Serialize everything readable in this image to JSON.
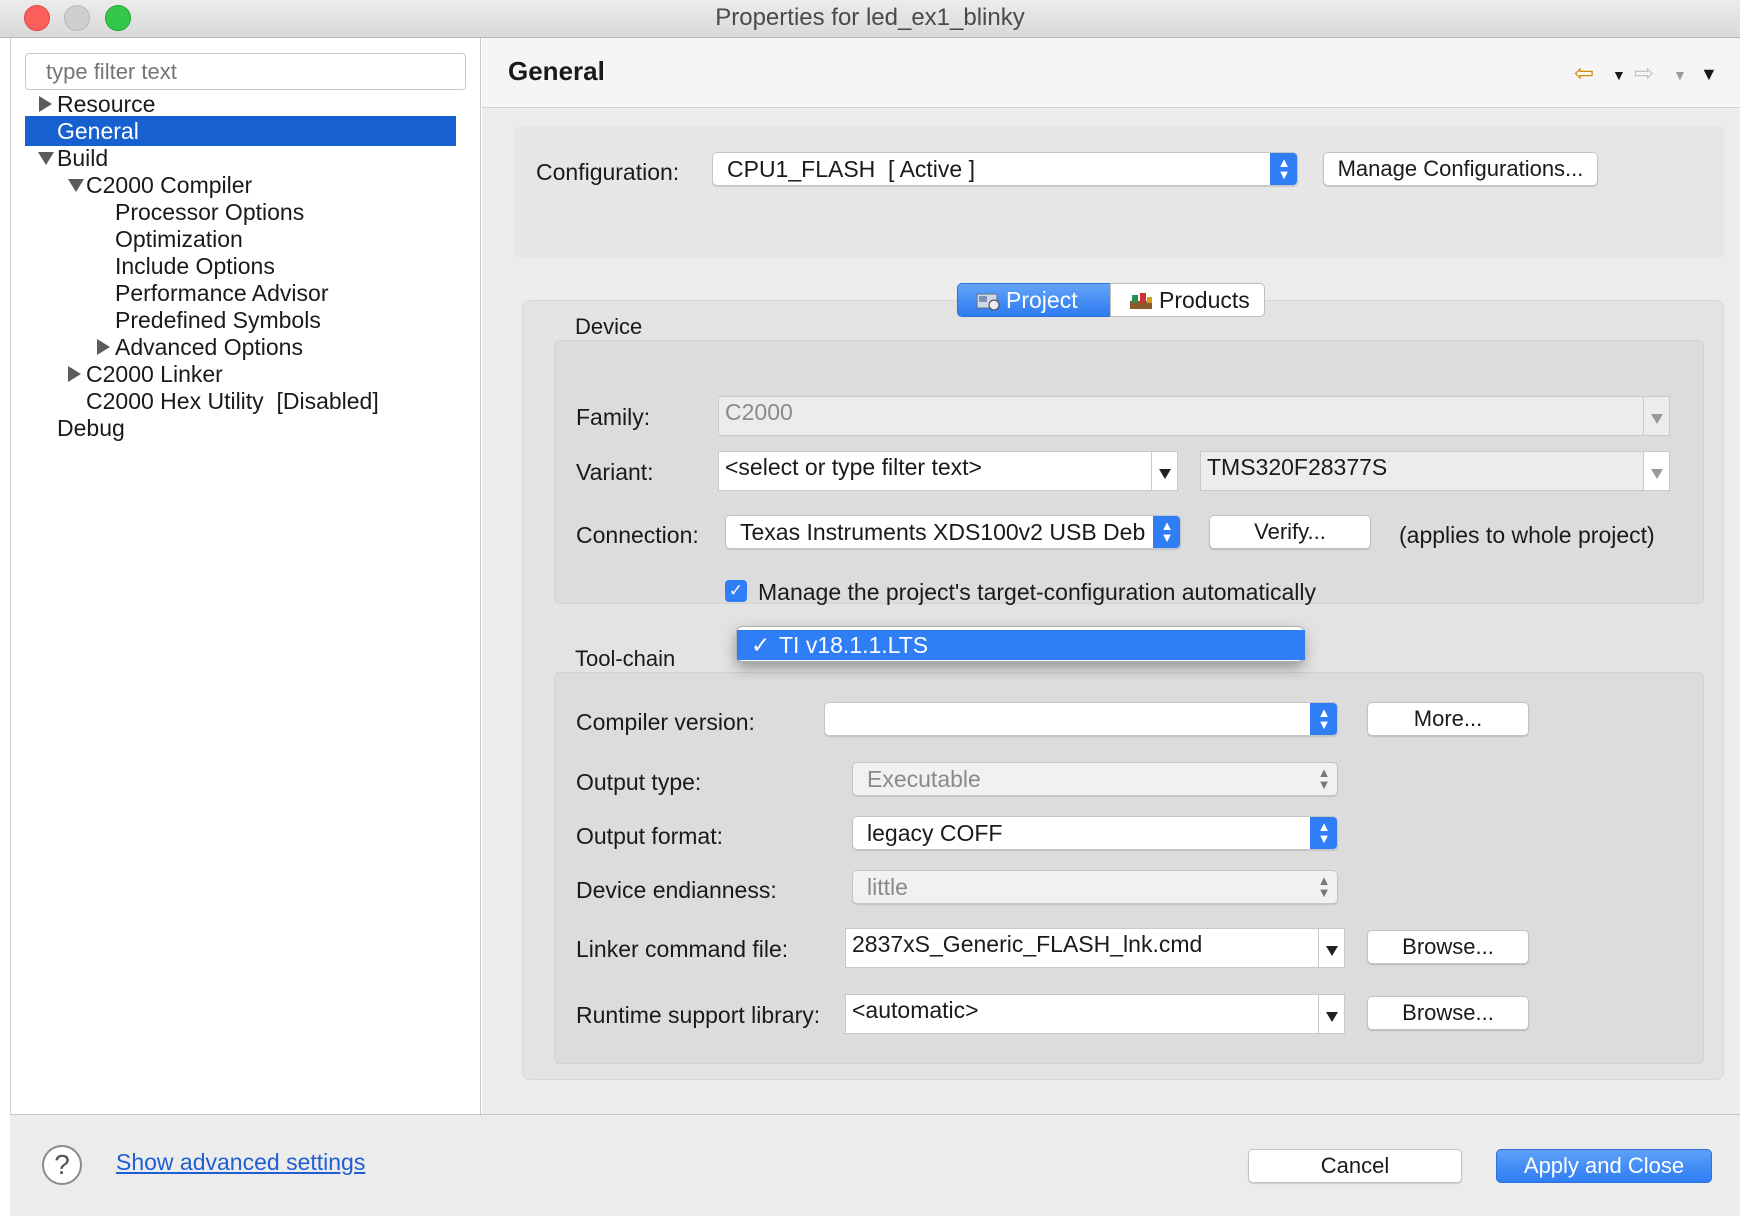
{
  "window": {
    "title": "Properties for led_ex1_blinky"
  },
  "sidebar": {
    "filter_placeholder": "type filter text",
    "items": [
      {
        "label": "Resource"
      },
      {
        "label": "General"
      },
      {
        "label": "Build"
      },
      {
        "label": "C2000 Compiler"
      },
      {
        "label": "Processor Options"
      },
      {
        "label": "Optimization"
      },
      {
        "label": "Include Options"
      },
      {
        "label": "Performance Advisor"
      },
      {
        "label": "Predefined Symbols"
      },
      {
        "label": "Advanced Options"
      },
      {
        "label": "C2000 Linker"
      },
      {
        "label": "C2000 Hex Utility  [Disabled]"
      },
      {
        "label": "Debug"
      }
    ],
    "selected": "General"
  },
  "main": {
    "title": "General",
    "configuration": {
      "label": "Configuration:",
      "value": "CPU1_FLASH  [ Active ]",
      "manage_label": "Manage Configurations..."
    },
    "tabs": [
      {
        "label": "Project",
        "active": true
      },
      {
        "label": "Products",
        "active": false
      }
    ],
    "device": {
      "title": "Device",
      "family_label": "Family:",
      "family_value": "C2000",
      "variant_label": "Variant:",
      "variant_filter": "<select or type filter text>",
      "variant_value": "TMS320F28377S",
      "connection_label": "Connection:",
      "connection_value": "Texas Instruments XDS100v2 USB Deb",
      "verify_label": "Verify...",
      "applies_note": "(applies to whole project)",
      "manage_target_label": "Manage the project's target-configuration automatically",
      "manage_target_checked": true
    },
    "toolchain": {
      "title": "Tool-chain",
      "compiler_label": "Compiler version:",
      "compiler_value": "TI v18.1.1.LTS",
      "more_label": "More...",
      "output_type_label": "Output type:",
      "output_type_value": "Executable",
      "output_format_label": "Output format:",
      "output_format_value": "legacy COFF",
      "endianness_label": "Device endianness:",
      "endianness_value": "little",
      "linker_cmd_label": "Linker command file:",
      "linker_cmd_value": "2837xS_Generic_FLASH_lnk.cmd",
      "browse_label": "Browse...",
      "runtime_label": "Runtime support library:",
      "runtime_value": "<automatic>",
      "browse2_label": "Browse..."
    }
  },
  "footer": {
    "advanced_link": "Show advanced settings",
    "cancel_label": "Cancel",
    "apply_label": "Apply and Close"
  },
  "colors": {
    "accent": "#2f7ef5",
    "selection": "#1660d0",
    "link": "#1f5fd1"
  },
  "icons": {
    "back": "arrow-left-icon",
    "forward": "arrow-right-icon",
    "menu": "menu-down-icon",
    "help": "help-icon",
    "check": "checkmark-icon"
  }
}
